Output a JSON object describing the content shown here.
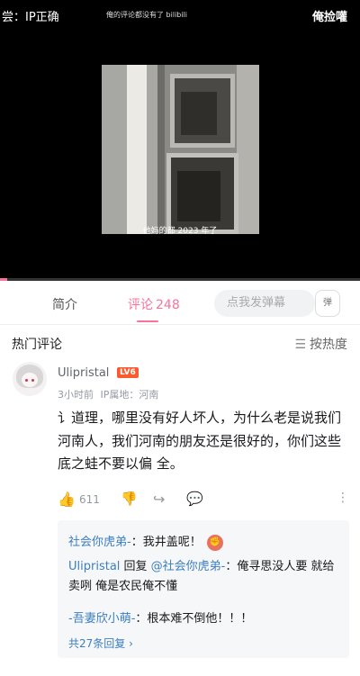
{
  "video": {
    "top_left_text": "尝：IP正确",
    "top_center_text": "俺的评论都没有了 bilibili",
    "top_right_text": "俺捡嚾",
    "subtitle": "他妈的都 2023 年了",
    "progress_fraction": 0.02
  },
  "tabs": {
    "intro_label": "简介",
    "comments_label": "评论",
    "comments_count": "248",
    "danmaku_placeholder": "点我发弹幕",
    "danmaku_button_label": "弹"
  },
  "comments_header": {
    "title": "热门评论",
    "sort_label": "按热度",
    "sort_icon": "menu-icon"
  },
  "comment": {
    "username": "Ulipristal",
    "level": "LV6",
    "time": "3小时前",
    "ip_label": "IP属地：",
    "ip_location": "河南",
    "text": "讠道理，哪里没有好人坏人，为什么老是说我们河南人，我们河南的朋友还是很好的，你们这些  底之蛙不要以偏  全。",
    "like_count": "611",
    "like_icon": "thumb-up-icon",
    "dislike_icon": "thumb-down-icon",
    "share_icon": "share-icon",
    "reply_icon": "reply-icon",
    "more_icon": "more-vertical-icon"
  },
  "replies": [
    {
      "name": "社会你虎弟-",
      "sep": "：",
      "text": "我井盖呢！",
      "emoji": "emoji-icon"
    },
    {
      "name": "Ulipristal",
      "reply_word": " 回复 ",
      "target": "@社会你虎弟-",
      "sep": "：",
      "text": "俺寻思没人要 就给卖咧 俺是农民俺不懂"
    },
    {
      "name": "-吾妻欣小萌-",
      "sep": "：",
      "text": "根本难不倒他！！！"
    }
  ],
  "more_replies_label": "共27条回复 ›"
}
